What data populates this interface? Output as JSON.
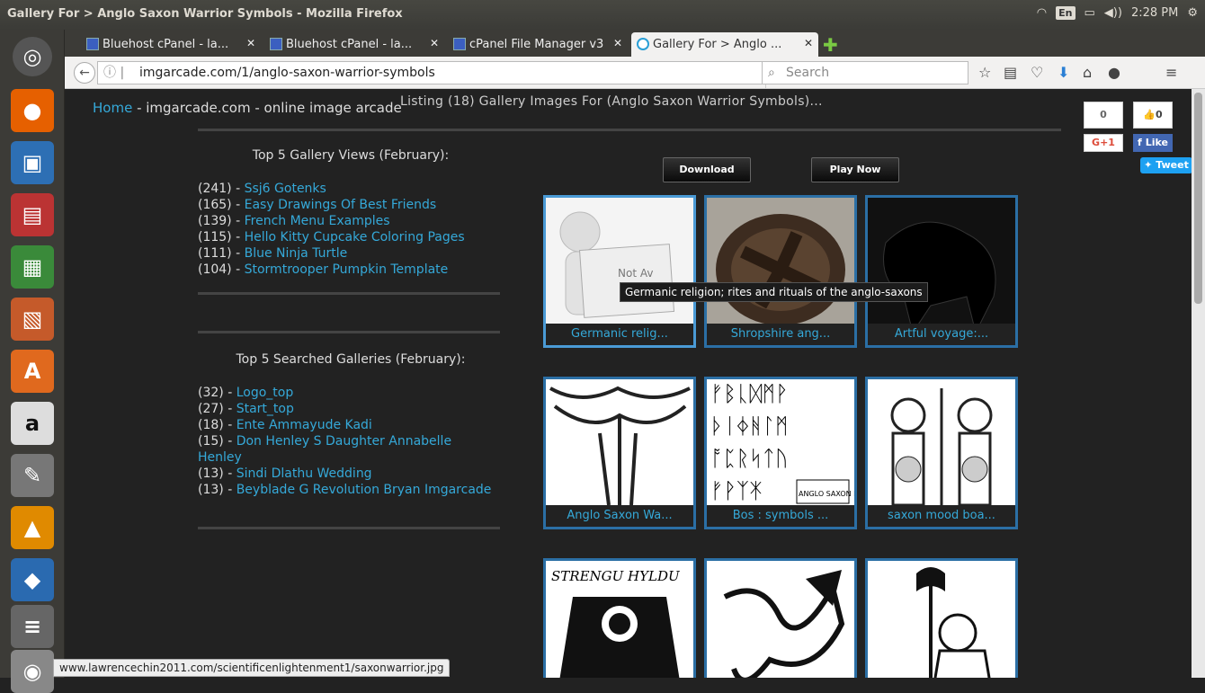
{
  "window": {
    "title": "Gallery For > Anglo Saxon Warrior Symbols - Mozilla Firefox",
    "lang": "En",
    "time": "2:28 PM"
  },
  "tabs": [
    {
      "label": "Bluehost cPanel - la..."
    },
    {
      "label": "Bluehost cPanel - la..."
    },
    {
      "label": "cPanel File Manager v3"
    },
    {
      "label": "Gallery For > Anglo ..."
    }
  ],
  "nav": {
    "url": "imgarcade.com/1/anglo-saxon-warrior-symbols",
    "search_placeholder": "Search"
  },
  "page": {
    "home": "Home",
    "home_rest": " - imgarcade.com - online image arcade",
    "listing": "Listing (18) Gallery Images For (Anglo Saxon Warrior Symbols)...",
    "top_views_title": "Top 5 Gallery Views (February):",
    "top_views": [
      {
        "count": "(241) - ",
        "name": "Ssj6 Gotenks"
      },
      {
        "count": "(165) - ",
        "name": "Easy Drawings Of Best Friends"
      },
      {
        "count": "(139) - ",
        "name": "French Menu Examples"
      },
      {
        "count": "(115) - ",
        "name": "Hello Kitty Cupcake Coloring Pages"
      },
      {
        "count": "(111) - ",
        "name": "Blue Ninja Turtle"
      },
      {
        "count": "(104) - ",
        "name": "Stormtrooper Pumpkin Template"
      }
    ],
    "top_searched_title": "Top 5 Searched Galleries (February):",
    "top_searched": [
      {
        "count": "(32) - ",
        "name": "Logo_top"
      },
      {
        "count": "(27) - ",
        "name": "Start_top"
      },
      {
        "count": "(18) - ",
        "name": "Ente Ammayude Kadi"
      },
      {
        "count": "(15) - ",
        "name": "Don Henley S Daughter Annabelle Henley"
      },
      {
        "count": "(13) - ",
        "name": "Sindi Dlathu Wedding"
      },
      {
        "count": "(13) - ",
        "name": "Beyblade G Revolution Bryan Imgarcade"
      }
    ],
    "download": "Download",
    "play_now": "Play Now",
    "thumbs": [
      {
        "caption": "Germanic relig...",
        "placeholder": "Not Av"
      },
      {
        "caption": "Shropshire ang..."
      },
      {
        "caption": "Artful voyage:..."
      },
      {
        "caption": "Anglo Saxon Wa..."
      },
      {
        "caption": "Bos : symbols ..."
      },
      {
        "caption": "saxon mood boa..."
      },
      {
        "caption": ""
      },
      {
        "caption": ""
      },
      {
        "caption": ""
      }
    ],
    "thumb_text": {
      "strengu": "STRENGU HYLDU",
      "runes": "ANGLO SAXON RUNES"
    },
    "tooltip": "Germanic religion; rites and rituals of the anglo-saxons",
    "social": {
      "gplus_count": "0",
      "gplus": "G+1",
      "fb_count": "0",
      "fb": "Like",
      "tweet": "Tweet"
    }
  },
  "status_url": "www.lawrencechin2011.com/scientificenlightenment1/saxonwarrior.jpg"
}
